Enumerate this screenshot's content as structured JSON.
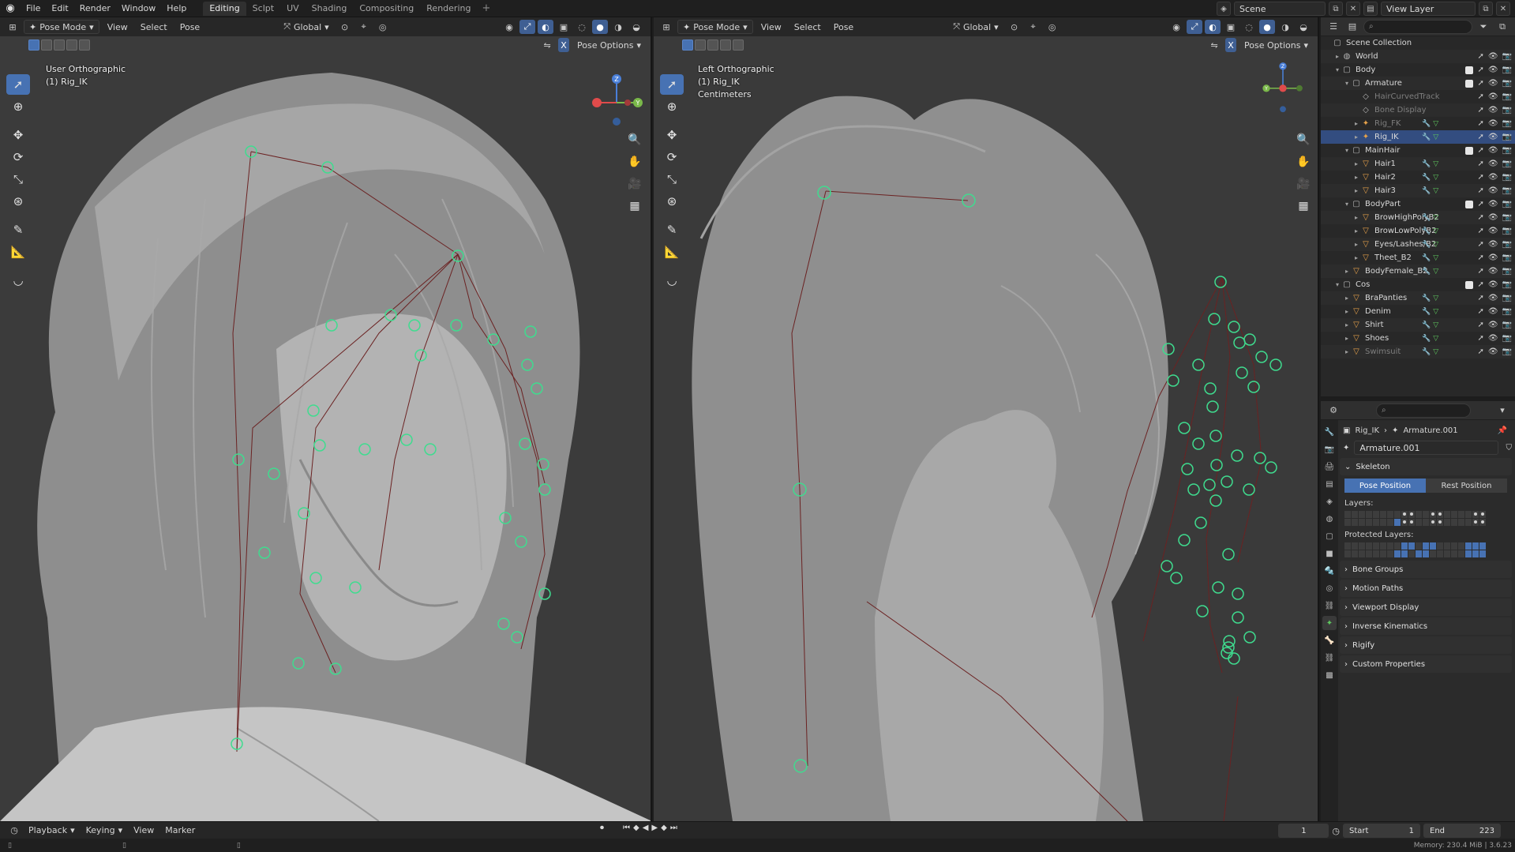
{
  "topbar": {
    "menus": [
      "File",
      "Edit",
      "Render",
      "Window",
      "Help"
    ],
    "workspaces": [
      "Editing",
      "Sclpt",
      "UV",
      "Shading",
      "Compositing",
      "Rendering"
    ],
    "active_workspace": "Editing",
    "scene": "Scene",
    "view_layer": "View Layer"
  },
  "viewport_left": {
    "mode": "Pose Mode",
    "menus": [
      "View",
      "Select",
      "Pose"
    ],
    "orientation": "Global",
    "pose_options": "Pose Options",
    "overlay_line1": "User Orthographic",
    "overlay_line2": "(1) Rig_IK"
  },
  "viewport_right": {
    "mode": "Pose Mode",
    "menus": [
      "View",
      "Select",
      "Pose"
    ],
    "orientation": "Global",
    "pose_options": "Pose Options",
    "overlay_line1": "Left Orthographic",
    "overlay_line2": "(1) Rig_IK",
    "overlay_line3": "Centimeters"
  },
  "gizmo": {
    "x_label": "X",
    "y_label": "Y",
    "z_label": "Z",
    "x_color": "#e04b4b",
    "y_color": "#7ab84a",
    "z_color": "#4a7fd8"
  },
  "outliner": {
    "rows": [
      {
        "label": "Scene Collection",
        "icon": "collection-icon",
        "arrow": ""
      },
      {
        "label": "World",
        "icon": "world-icon",
        "arrow": "▸"
      },
      {
        "label": "Body",
        "icon": "collection-icon",
        "arrow": "▾"
      },
      {
        "label": "Armature",
        "icon": "collection-icon",
        "arrow": "▾"
      },
      {
        "label": "HairCurvedTrack",
        "icon": "object-icon",
        "arrow": ""
      },
      {
        "label": "Bone Display",
        "icon": "object-icon",
        "arrow": ""
      },
      {
        "label": "Rig_FK",
        "icon": "armature-icon",
        "arrow": "▸"
      },
      {
        "label": "Rig_IK",
        "icon": "armature-icon",
        "arrow": "▸"
      },
      {
        "label": "MainHair",
        "icon": "collection-icon",
        "arrow": "▾"
      },
      {
        "label": "Hair1",
        "icon": "mesh-icon",
        "arrow": "▸"
      },
      {
        "label": "Hair2",
        "icon": "mesh-icon",
        "arrow": "▸"
      },
      {
        "label": "Hair3",
        "icon": "mesh-icon",
        "arrow": "▸"
      },
      {
        "label": "BodyPart",
        "icon": "collection-icon",
        "arrow": "▾"
      },
      {
        "label": "BrowHighPolyB2",
        "icon": "mesh-icon",
        "arrow": "▸"
      },
      {
        "label": "BrowLowPolyB2",
        "icon": "mesh-icon",
        "arrow": "▸"
      },
      {
        "label": "Eyes/Lashes/B2",
        "icon": "mesh-icon",
        "arrow": "▸"
      },
      {
        "label": "Theet_B2",
        "icon": "mesh-icon",
        "arrow": "▸"
      },
      {
        "label": "BodyFemale_B2",
        "icon": "mesh-icon",
        "arrow": "▸"
      },
      {
        "label": "Cos",
        "icon": "collection-icon",
        "arrow": "▾"
      },
      {
        "label": "BraPanties",
        "icon": "mesh-icon",
        "arrow": "▸"
      },
      {
        "label": "Denim",
        "icon": "mesh-icon",
        "arrow": "▸"
      },
      {
        "label": "Shirt",
        "icon": "mesh-icon",
        "arrow": "▸"
      },
      {
        "label": "Shoes",
        "icon": "mesh-icon",
        "arrow": "▸"
      },
      {
        "label": "Swimsuit",
        "icon": "mesh-icon",
        "arrow": "▸"
      }
    ]
  },
  "properties": {
    "breadcrumb_object": "Rig_IK",
    "breadcrumb_data": "Armature.001",
    "datablock": "Armature.001",
    "skeleton_panel": "Skeleton",
    "pose_position": "Pose Position",
    "rest_position": "Rest Position",
    "layers_label": "Layers:",
    "protected_layers_label": "Protected Layers:",
    "panels": [
      "Bone Groups",
      "Motion Paths",
      "Viewport Display",
      "Inverse Kinematics",
      "Rigify",
      "Custom Properties"
    ]
  },
  "timeline": {
    "menus": [
      "Playback",
      "Keying",
      "View",
      "Marker"
    ],
    "current_frame": "1",
    "start_label": "Start",
    "start_value": "1",
    "end_label": "End",
    "end_value": "223"
  },
  "statusbar": {
    "memory": "Memory: 230.4 MiB | 3.6.23"
  }
}
